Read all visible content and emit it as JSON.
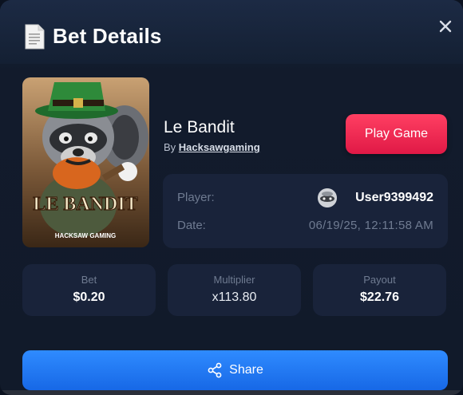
{
  "modal": {
    "title": "Bet Details",
    "icons": {
      "title": "document-icon",
      "close": "close-icon",
      "share": "share-icon"
    }
  },
  "game": {
    "name": "Le Bandit",
    "by_prefix": "By",
    "provider": "Hacksawgaming",
    "thumbnail_title": "LE BANDIT",
    "thumbnail_studio": "HACKSAW GAMING",
    "play_label": "Play Game"
  },
  "details": {
    "player_label": "Player:",
    "player_name": "User9399492",
    "date_label": "Date:",
    "date_value": "06/19/25, 12:11:58 AM"
  },
  "stats": {
    "bet_label": "Bet",
    "bet_value": "$0.20",
    "multiplier_label": "Multiplier",
    "multiplier_value": "x113.80",
    "payout_label": "Payout",
    "payout_value": "$22.76"
  },
  "share_label": "Share",
  "colors": {
    "accent_play": "#e91f4b",
    "accent_share": "#1f77f2",
    "card_bg": "#19233a",
    "muted_text": "#6f7b91"
  }
}
